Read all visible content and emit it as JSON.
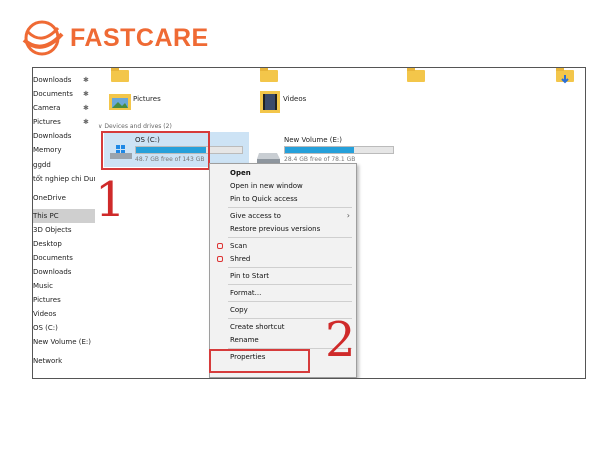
{
  "brand": {
    "name": "FASTCARE"
  },
  "sidebar": {
    "items": [
      {
        "label": "Downloads",
        "pinned": true
      },
      {
        "label": "Documents",
        "pinned": true
      },
      {
        "label": "Camera",
        "pinned": true
      },
      {
        "label": "Pictures",
        "pinned": true
      },
      {
        "label": "Downloads",
        "pinned": false
      },
      {
        "label": "Memory",
        "pinned": false
      },
      {
        "label": "ggdd",
        "pinned": false
      },
      {
        "label": "tốt nghiep chi Dung",
        "pinned": false
      },
      {
        "label": "OneDrive",
        "pinned": false
      },
      {
        "label": "This PC",
        "selected": true
      },
      {
        "label": "3D Objects"
      },
      {
        "label": "Desktop"
      },
      {
        "label": "Documents"
      },
      {
        "label": "Downloads"
      },
      {
        "label": "Music"
      },
      {
        "label": "Pictures"
      },
      {
        "label": "Videos"
      },
      {
        "label": "OS (C:)"
      },
      {
        "label": "New Volume (E:)"
      },
      {
        "label": "Network"
      }
    ]
  },
  "content": {
    "folders": [
      {
        "label": "Pictures"
      },
      {
        "label": "Videos"
      }
    ],
    "section_title": "Devices and drives (2)",
    "drives": [
      {
        "name": "OS (C:)",
        "free": "48.7 GB free of 143 GB",
        "used_fraction": 0.66
      },
      {
        "name": "New Volume (E:)",
        "free": "28.4 GB free of 78.1 GB",
        "used_fraction": 0.64
      }
    ]
  },
  "context_menu": {
    "items": [
      {
        "label": "Open",
        "bold": true
      },
      {
        "label": "Open in new window"
      },
      {
        "label": "Pin to Quick access"
      },
      {
        "label": "Give access to",
        "submenu": true
      },
      {
        "label": "Restore previous versions"
      },
      {
        "label": "Scan",
        "icon": "antivirus-icon"
      },
      {
        "label": "Shred",
        "icon": "antivirus-icon"
      },
      {
        "label": "Pin to Start"
      },
      {
        "label": "Format..."
      },
      {
        "label": "Copy"
      },
      {
        "label": "Create shortcut"
      },
      {
        "label": "Rename"
      },
      {
        "label": "Properties"
      }
    ]
  },
  "annotations": {
    "step1": "1",
    "step2": "2"
  },
  "colors": {
    "brand": "#ef6a34",
    "accent_red": "#d63b3b",
    "drive_bar": "#26a0da",
    "selection": "#cde3f5"
  }
}
